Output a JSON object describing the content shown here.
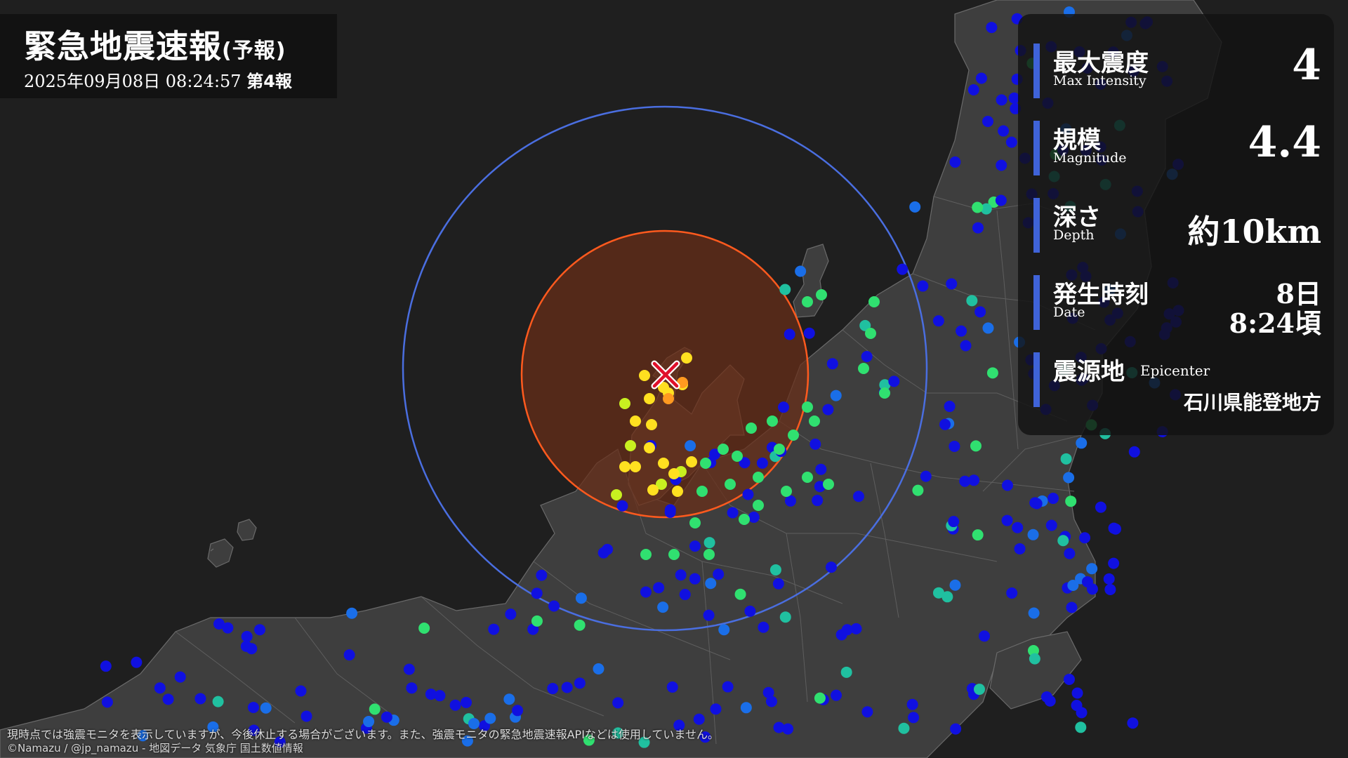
{
  "title": {
    "main": "緊急地震速報",
    "sub": "(予報)",
    "datetime": "2025年09月08日 08:24:57",
    "report": "第4報"
  },
  "info": {
    "max_intensity": {
      "label_jp": "最大震度",
      "label_en": "Max Intensity",
      "value": "4"
    },
    "magnitude": {
      "label_jp": "規模",
      "label_en": "Magnitude",
      "value": "4.4"
    },
    "depth": {
      "label_jp": "深さ",
      "label_en": "Depth",
      "value": "約10km"
    },
    "origin_time": {
      "label_jp": "発生時刻",
      "label_en": "Date",
      "day": "8日",
      "time": "8:24頃"
    },
    "epicenter": {
      "label_jp": "震源地",
      "label_en": "Epicenter",
      "value": "石川県能登地方"
    }
  },
  "map": {
    "epicenter_marker": "epicenter-x-icon",
    "colors": {
      "p_wave_circle": "#4a6ee0",
      "s_wave_circle": "#ff5a1e",
      "s_wave_fill": "#6a2e18",
      "accent_bar": "#3f63d8",
      "station_low": "#1010e0",
      "station_mid": "#30e070",
      "station_high": "#ffe020",
      "station_max": "#ff9a20"
    }
  },
  "footer": {
    "notice": "現時点では強震モニタを表示していますが、今後休止する場合がございます。また、強震モニタの緊急地震速報APIなどは使用していません。",
    "credit": "©Namazu / @jp_namazu - 地図データ 気象庁 国土数値情報"
  }
}
